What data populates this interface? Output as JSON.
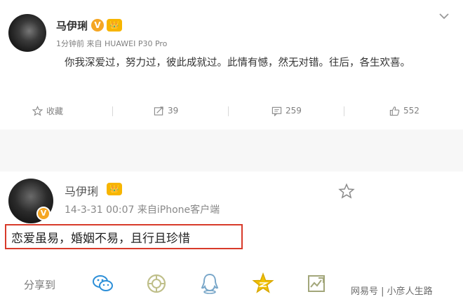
{
  "post1": {
    "author": "马伊琍",
    "verified_badge": "V",
    "member_badge": "👑",
    "time": "1分钟前",
    "source_prefix": "来自",
    "source": "HUAWEI P30 Pro",
    "text": "你我深爱过，努力过，彼此成就过。此情有憾，然无对错。往后，各生欢喜。",
    "actions": {
      "favorite_label": "收藏",
      "repost_count": "39",
      "comment_count": "259",
      "like_count": "552"
    }
  },
  "post2": {
    "author": "马伊琍",
    "verified_badge": "V",
    "member_badge": "👑",
    "time": "14-3-31 00:07",
    "source_prefix": "来自",
    "source": "iPhone客户端",
    "text": "恋爱虽易，婚姻不易，且行且珍惜",
    "share_label": "分享到",
    "share_targets": [
      "wechat-icon",
      "moments-icon",
      "qq-icon",
      "qzone-icon",
      "weibo-icon"
    ]
  },
  "watermark": "网易号 | 小彦人生路",
  "colors": {
    "highlight_border": "#d83a2a",
    "verified": "#f5a623",
    "member": "#f7b500",
    "muted_text": "#808080"
  }
}
